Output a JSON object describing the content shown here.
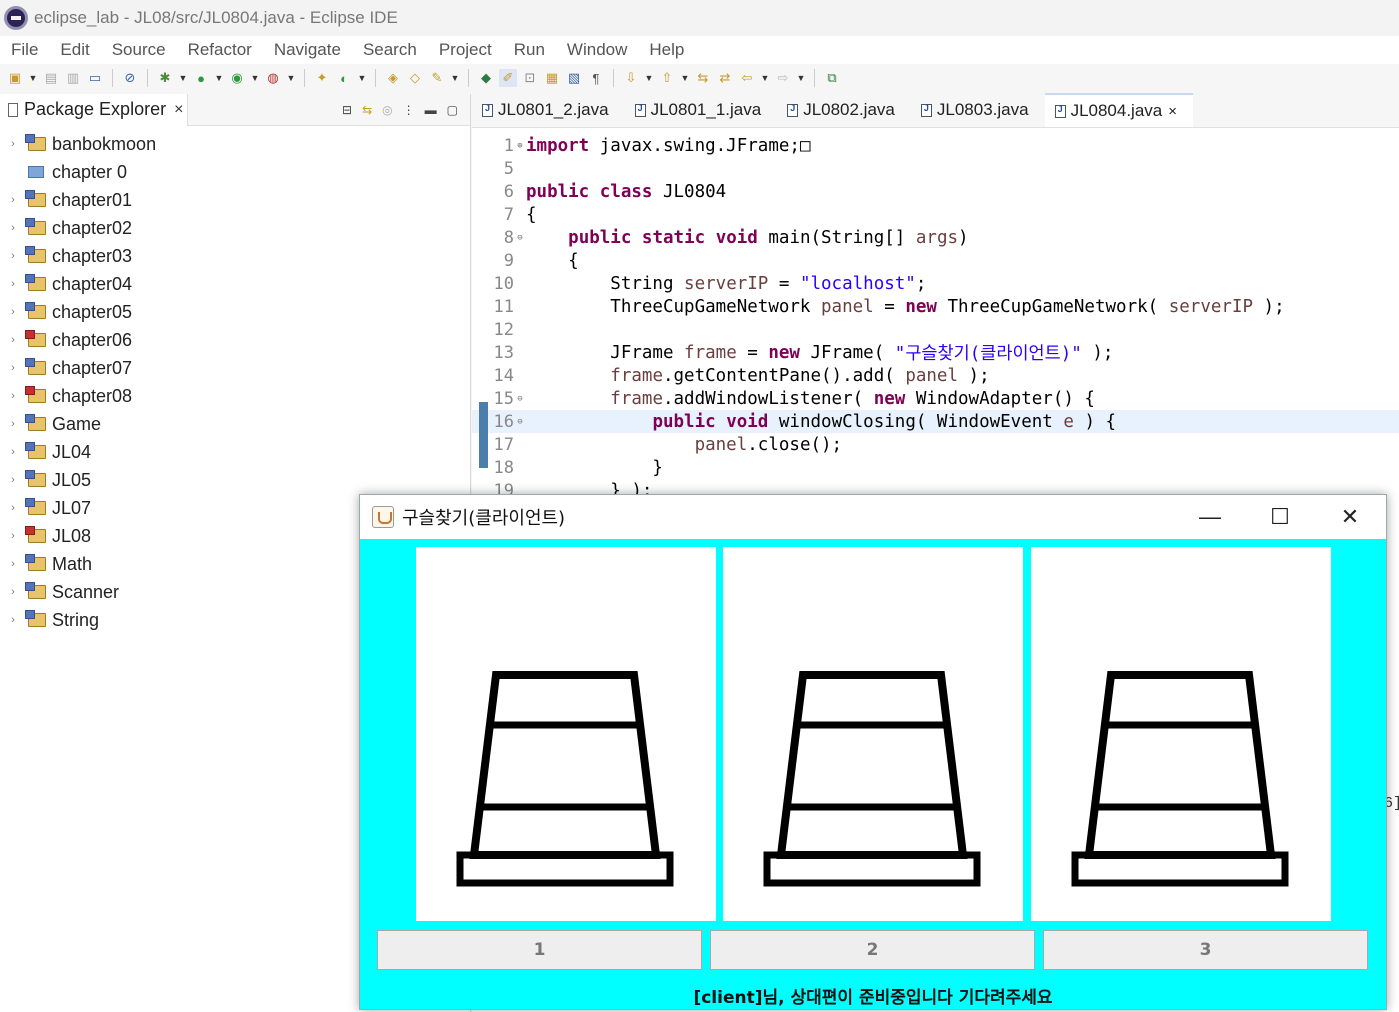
{
  "window": {
    "title": "eclipse_lab - JL08/src/JL0804.java - Eclipse IDE"
  },
  "menu": [
    "File",
    "Edit",
    "Source",
    "Refactor",
    "Navigate",
    "Search",
    "Project",
    "Run",
    "Window",
    "Help"
  ],
  "package_explorer": {
    "title": "Package Explorer",
    "items": [
      {
        "label": "banbokmoon",
        "type": "project",
        "error": false
      },
      {
        "label": "chapter 0",
        "type": "folder",
        "error": false
      },
      {
        "label": "chapter01",
        "type": "project",
        "error": false
      },
      {
        "label": "chapter02",
        "type": "project",
        "error": false
      },
      {
        "label": "chapter03",
        "type": "project",
        "error": false
      },
      {
        "label": "chapter04",
        "type": "project",
        "error": false
      },
      {
        "label": "chapter05",
        "type": "project",
        "error": false
      },
      {
        "label": "chapter06",
        "type": "project",
        "error": true
      },
      {
        "label": "chapter07",
        "type": "project",
        "error": false
      },
      {
        "label": "chapter08",
        "type": "project",
        "error": true
      },
      {
        "label": "Game",
        "type": "project",
        "error": false
      },
      {
        "label": "JL04",
        "type": "project",
        "error": false
      },
      {
        "label": "JL05",
        "type": "project",
        "error": false
      },
      {
        "label": "JL07",
        "type": "project",
        "error": false
      },
      {
        "label": "JL08",
        "type": "project",
        "error": true
      },
      {
        "label": "Math",
        "type": "project",
        "error": false
      },
      {
        "label": "Scanner",
        "type": "project",
        "error": false
      },
      {
        "label": "String",
        "type": "project",
        "error": false
      }
    ]
  },
  "editor": {
    "tabs": [
      "JL0801_2.java",
      "JL0801_1.java",
      "JL0802.java",
      "JL0803.java",
      "JL0804.java"
    ],
    "active_tab": "JL0804.java",
    "code": [
      {
        "n": "1",
        "fold": "⊕",
        "hl": false,
        "segs": [
          [
            "kw",
            "import"
          ],
          [
            "t",
            " javax.swing.JFrame;"
          ],
          [
            "t",
            "□"
          ]
        ]
      },
      {
        "n": "5",
        "fold": "",
        "hl": false,
        "segs": []
      },
      {
        "n": "6",
        "fold": "",
        "hl": false,
        "segs": [
          [
            "kw",
            "public"
          ],
          [
            "t",
            " "
          ],
          [
            "kw",
            "class"
          ],
          [
            "t",
            " JL0804"
          ]
        ]
      },
      {
        "n": "7",
        "fold": "",
        "hl": false,
        "segs": [
          [
            "t",
            "{"
          ]
        ]
      },
      {
        "n": "8",
        "fold": "⊖",
        "hl": false,
        "segs": [
          [
            "t",
            "    "
          ],
          [
            "kw",
            "public"
          ],
          [
            "t",
            " "
          ],
          [
            "kw",
            "static"
          ],
          [
            "t",
            " "
          ],
          [
            "kw",
            "void"
          ],
          [
            "t",
            " main(String[] "
          ],
          [
            "var",
            "args"
          ],
          [
            "t",
            ")"
          ]
        ]
      },
      {
        "n": "9",
        "fold": "",
        "hl": false,
        "segs": [
          [
            "t",
            "    {"
          ]
        ]
      },
      {
        "n": "10",
        "fold": "",
        "hl": false,
        "segs": [
          [
            "t",
            "        String "
          ],
          [
            "var",
            "serverIP"
          ],
          [
            "t",
            " = "
          ],
          [
            "str",
            "\"localhost\""
          ],
          [
            "t",
            ";"
          ]
        ]
      },
      {
        "n": "11",
        "fold": "",
        "hl": false,
        "segs": [
          [
            "t",
            "        ThreeCupGameNetwork "
          ],
          [
            "var",
            "panel"
          ],
          [
            "t",
            " = "
          ],
          [
            "kw",
            "new"
          ],
          [
            "t",
            " ThreeCupGameNetwork( "
          ],
          [
            "var",
            "serverIP"
          ],
          [
            "t",
            " );"
          ]
        ]
      },
      {
        "n": "12",
        "fold": "",
        "hl": false,
        "segs": []
      },
      {
        "n": "13",
        "fold": "",
        "hl": false,
        "segs": [
          [
            "t",
            "        JFrame "
          ],
          [
            "var",
            "frame"
          ],
          [
            "t",
            " = "
          ],
          [
            "kw",
            "new"
          ],
          [
            "t",
            " JFrame( "
          ],
          [
            "str",
            "\"구슬찾기(클라이언트)\""
          ],
          [
            "t",
            " );"
          ]
        ]
      },
      {
        "n": "14",
        "fold": "",
        "hl": false,
        "segs": [
          [
            "t",
            "        "
          ],
          [
            "var",
            "frame"
          ],
          [
            "t",
            ".getContentPane().add( "
          ],
          [
            "var",
            "panel"
          ],
          [
            "t",
            " );"
          ]
        ]
      },
      {
        "n": "15",
        "fold": "⊖",
        "hl": false,
        "segs": [
          [
            "t",
            "        "
          ],
          [
            "var",
            "frame"
          ],
          [
            "t",
            ".addWindowListener( "
          ],
          [
            "kw",
            "new"
          ],
          [
            "t",
            " WindowAdapter() {"
          ]
        ]
      },
      {
        "n": "16",
        "fold": "⊖",
        "hl": true,
        "segs": [
          [
            "t",
            "            "
          ],
          [
            "kw",
            "public"
          ],
          [
            "t",
            " "
          ],
          [
            "kw",
            "void"
          ],
          [
            "t",
            " windowClosing( WindowEvent "
          ],
          [
            "var",
            "e"
          ],
          [
            "t",
            " ) {"
          ]
        ]
      },
      {
        "n": "17",
        "fold": "",
        "hl": false,
        "segs": [
          [
            "t",
            "                "
          ],
          [
            "var",
            "panel"
          ],
          [
            "t",
            ".close();"
          ]
        ]
      },
      {
        "n": "18",
        "fold": "",
        "hl": false,
        "segs": [
          [
            "t",
            "            }"
          ]
        ]
      },
      {
        "n": "19",
        "fold": "",
        "hl": false,
        "segs": [
          [
            "t",
            "        } );"
          ]
        ]
      }
    ]
  },
  "background_fragment": "6]",
  "dialog": {
    "title": "구슬찾기(클라이언트)",
    "buttons": [
      "1",
      "2",
      "3"
    ],
    "status": "[client]님, 상대편이 준비중입니다 기다려주세요",
    "background_color": "#00ffff"
  }
}
